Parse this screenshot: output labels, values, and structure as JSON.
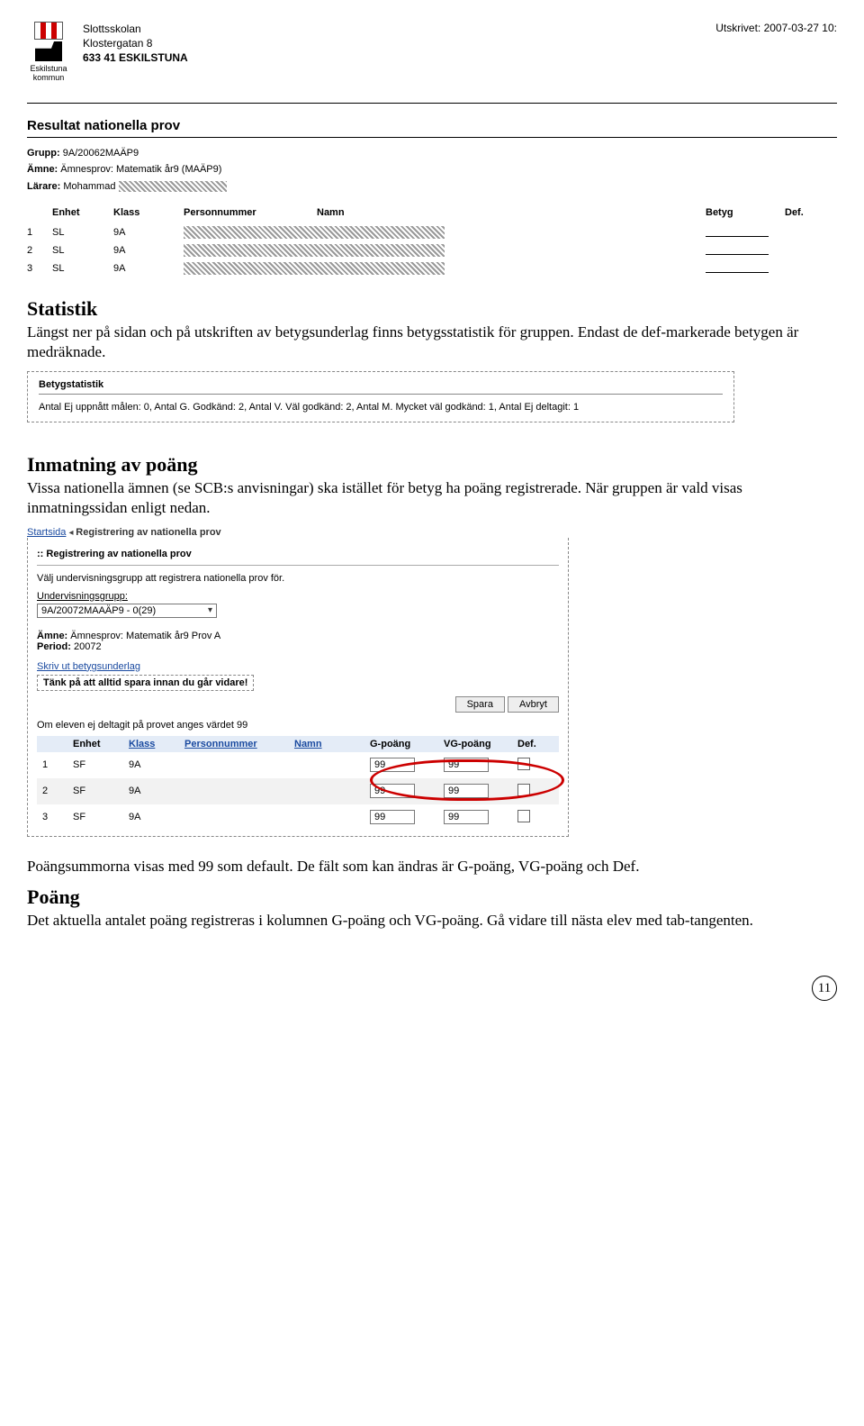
{
  "print_line": "Utskrivet: 2007-03-27 10:",
  "school": {
    "name": "Slottsskolan",
    "street": "Klostergatan 8",
    "postal": "633 41 ESKILSTUNA",
    "logo_caption": "Eskilstuna kommun"
  },
  "report_title": "Resultat nationella prov",
  "group": {
    "label": "Grupp:",
    "value": "9A/20062MAÄP9"
  },
  "subject": {
    "label": "Ämne:",
    "value": "Ämnesprov: Matematik år9 (MAÄP9)"
  },
  "teacher": {
    "label": "Lärare:",
    "value": "Mohammad"
  },
  "table1_headers": [
    "",
    "Enhet",
    "Klass",
    "Personnummer",
    "Namn",
    "Betyg",
    "Def."
  ],
  "table1_rows": [
    {
      "n": "1",
      "enhet": "SL",
      "klass": "9A"
    },
    {
      "n": "2",
      "enhet": "SL",
      "klass": "9A"
    },
    {
      "n": "3",
      "enhet": "SL",
      "klass": "9A"
    }
  ],
  "sec_stat_title": "Statistik",
  "sec_stat_body": "Längst ner på sidan och på utskriften av betygsunderlag finns betygsstatistik för gruppen. Endast de def-markerade betygen är medräknade.",
  "stats": {
    "title": "Betygstatistik",
    "line": "Antal Ej uppnått målen: 0, Antal G. Godkänd: 2, Antal V. Väl godkänd: 2, Antal M. Mycket väl godkänd: 1, Antal Ej deltagit: 1"
  },
  "sec_inmat_title": "Inmatning av poäng",
  "sec_inmat_body": "Vissa nationella ämnen (se SCB:s anvisningar) ska istället för betyg ha poäng registrerade. När gruppen är vald visas inmatningssidan enligt nedan.",
  "breadcrumb": {
    "start": "Startsida",
    "current": "Registrering av nationella prov"
  },
  "panel": {
    "title": ":: Registrering av nationella prov",
    "instr": "Välj undervisningsgrupp att registrera nationella prov för.",
    "ug_label": "Undervisningsgrupp:",
    "ug_value": "9A/20072MAAÄP9 - 0(29)",
    "amne_label": "Ämne:",
    "amne_value": "Ämnesprov: Matematik år9 Prov A",
    "period_label": "Period:",
    "period_value": "20072",
    "print_link": "Skriv ut betygsunderlag",
    "warn": "Tänk på att alltid spara innan du går vidare!",
    "save": "Spara",
    "cancel": "Avbryt",
    "note99": "Om eleven ej deltagit på provet anges värdet 99",
    "cols": [
      "",
      "Enhet",
      "Klass",
      "Personnummer",
      "Namn",
      "G-poäng",
      "VG-poäng",
      "Def."
    ],
    "rows": [
      {
        "n": "1",
        "enhet": "SF",
        "klass": "9A",
        "g": "99",
        "vg": "99"
      },
      {
        "n": "2",
        "enhet": "SF",
        "klass": "9A",
        "g": "99",
        "vg": "99"
      },
      {
        "n": "3",
        "enhet": "SF",
        "klass": "9A",
        "g": "99",
        "vg": "99"
      }
    ]
  },
  "tail1": "Poängsummorna visas med 99 som default. De fält som kan ändras är G-poäng, VG-poäng och Def.",
  "tail_heading": "Poäng",
  "tail2": "Det aktuella antalet poäng registreras i kolumnen G-poäng och VG-poäng. Gå vidare till nästa elev med tab-tangenten.",
  "page_number": "11"
}
